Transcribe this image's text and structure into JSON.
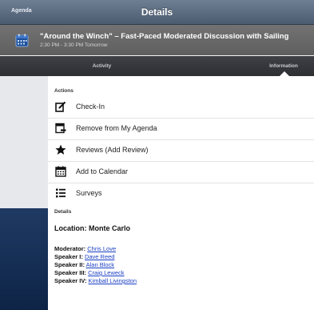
{
  "nav": {
    "back_label": "Agenda",
    "title": "Details"
  },
  "session": {
    "title": "\"Around the Winch\" – Fast-Paced Moderated Discussion with Sailing",
    "time": "2:30 PM - 3:30 PM Tomorrow"
  },
  "tabs": [
    {
      "label": "Activity",
      "selected": false
    },
    {
      "label": "Information",
      "selected": true
    }
  ],
  "actions": {
    "header": "Actions",
    "items": [
      {
        "label": "Check-In",
        "icon": "check-in-icon"
      },
      {
        "label": "Remove from My Agenda",
        "icon": "agenda-remove-icon"
      },
      {
        "label": "Reviews (Add Review)",
        "icon": "star-icon"
      },
      {
        "label": "Add to Calendar",
        "icon": "calendar-icon"
      },
      {
        "label": "Surveys",
        "icon": "list-icon"
      }
    ]
  },
  "details": {
    "header": "Details",
    "location": "Location: Monte Carlo",
    "people": [
      {
        "role": "Moderator:",
        "name": "Chris Love"
      },
      {
        "role": "Speaker I:",
        "name": "Dave Reed"
      },
      {
        "role": "Speaker II:",
        "name": "Alan Block"
      },
      {
        "role": "Speaker III:",
        "name": "Craig Leweck"
      },
      {
        "role": "Speaker IV:",
        "name": "Kimball Livingston"
      }
    ]
  },
  "colors": {
    "navbar": "#5d6d82",
    "header": "#686868",
    "tabbar": "#35373b",
    "link": "#1a3fc4"
  }
}
